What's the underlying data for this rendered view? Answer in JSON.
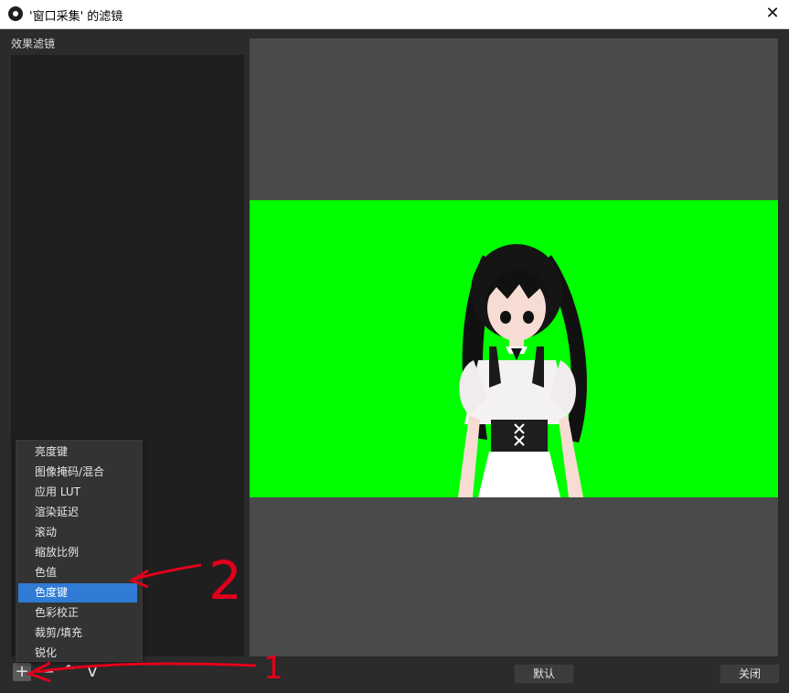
{
  "window": {
    "title": "'窗口采集' 的滤镜",
    "close_glyph": "✕"
  },
  "filters_panel": {
    "label": "效果滤镜"
  },
  "menu": {
    "items": [
      {
        "label": "亮度键",
        "selected": false
      },
      {
        "label": "图像掩码/混合",
        "selected": false
      },
      {
        "label": "应用 LUT",
        "selected": false
      },
      {
        "label": "渲染延迟",
        "selected": false
      },
      {
        "label": "滚动",
        "selected": false
      },
      {
        "label": "缩放比例",
        "selected": false
      },
      {
        "label": "色值",
        "selected": false
      },
      {
        "label": "色度键",
        "selected": true
      },
      {
        "label": "色彩校正",
        "selected": false
      },
      {
        "label": "裁剪/填充",
        "selected": false
      },
      {
        "label": "锐化",
        "selected": false
      }
    ]
  },
  "toolbar": {
    "add_glyph": "+",
    "remove_glyph": "—",
    "up_glyph": "^",
    "down_glyph": "v",
    "defaults_label": "默认",
    "close_label": "关闭"
  },
  "colors": {
    "accent_selected": "#2f7bd5",
    "chroma_green": "#00ff00",
    "annotation_red": "#e0001b"
  },
  "annotations": {
    "label_1": "1",
    "label_2": "2"
  }
}
